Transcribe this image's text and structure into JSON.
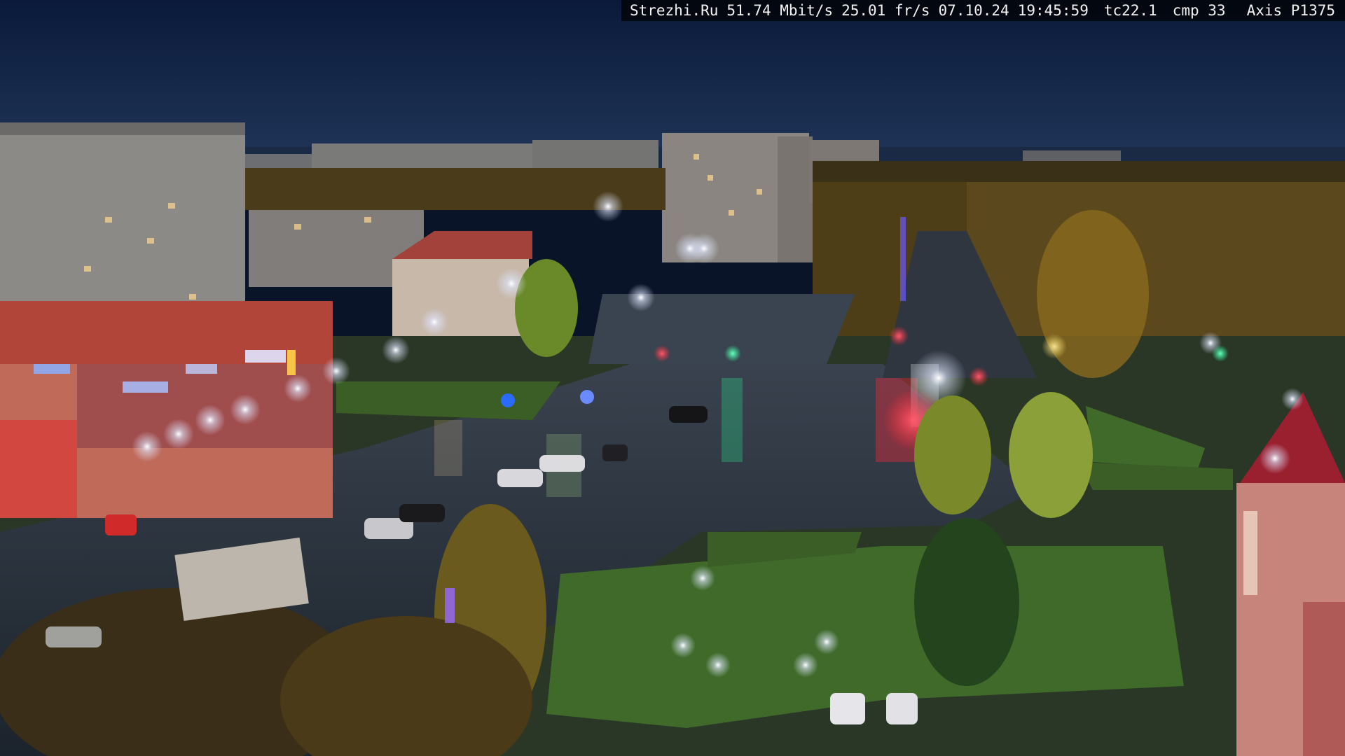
{
  "osd": {
    "site": "Strezhi.Ru",
    "bitrate": "51.74 Mbit/s",
    "framerate": "25.01 fr/s",
    "date": "07.10.24",
    "time": "19:45:59",
    "tc": "tc22.1",
    "cmp": "cmp 33",
    "camera": "Axis P1375"
  },
  "scene": {
    "description_icon": "camera-feed-image",
    "colors": {
      "sky_top": "#0b1a3a",
      "sky_bottom": "#22375e",
      "asphalt": "#2c3440",
      "grass": "#3f6a2a",
      "tree_autumn": "#8a6a1e",
      "light_white": "#f4f7ff",
      "light_red": "#ff2a3a",
      "light_green": "#2aff9a",
      "building_panel": "#8c8a86",
      "shop_red": "#b2453a"
    }
  }
}
